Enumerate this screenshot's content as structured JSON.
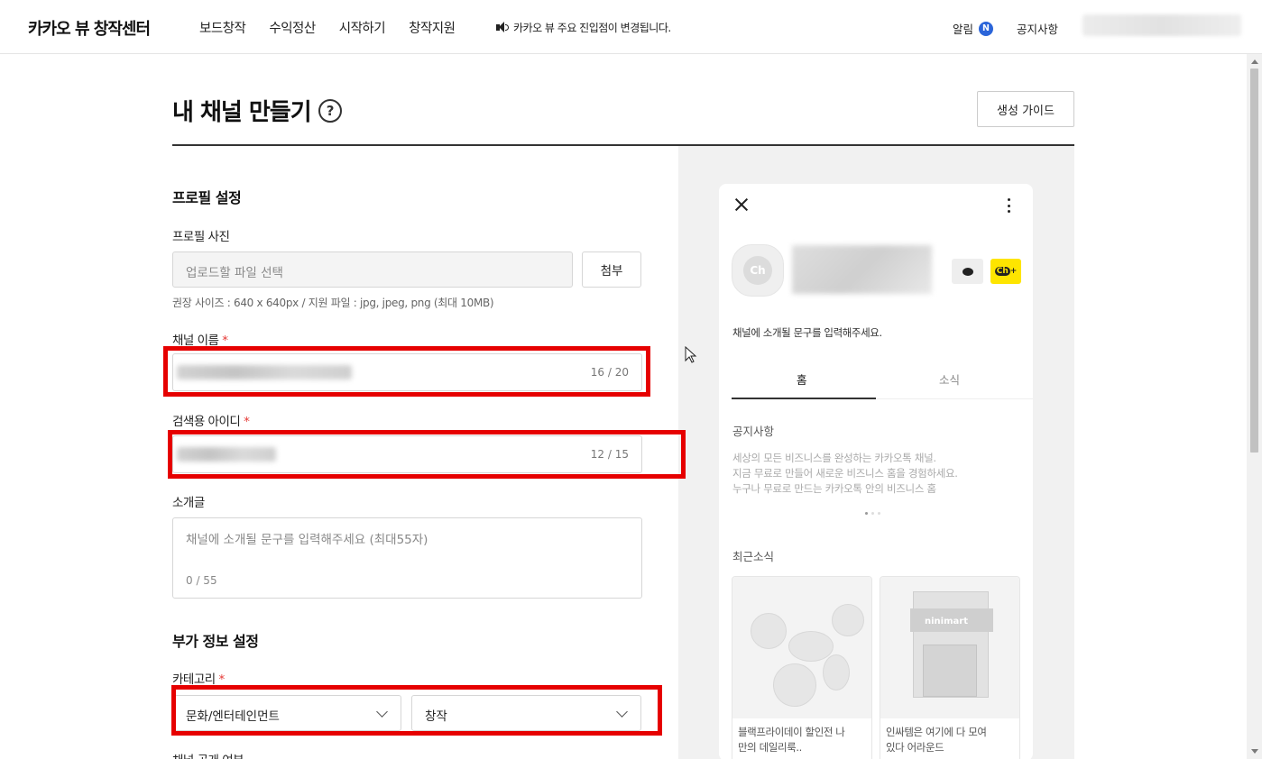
{
  "header": {
    "logo": "카카오 뷰 창작센터",
    "nav": [
      "보드창작",
      "수익정산",
      "시작하기",
      "창작지원"
    ],
    "notice": "카카오 뷰 주요 진입점이 변경됩니다.",
    "alarm_label": "알림",
    "alarm_badge": "N",
    "notice_link": "공지사항"
  },
  "page": {
    "title": "내 채널 만들기",
    "help_glyph": "?",
    "guide_button": "생성 가이드"
  },
  "profile": {
    "section_title": "프로필 설정",
    "photo_label": "프로필 사진",
    "photo_placeholder": "업로드할 파일 선택",
    "attach_button": "첨부",
    "photo_hint": "권장 사이즈 : 640 x 640px / 지원 파일 : jpg, jpeg, png (최대 10MB)",
    "name_label": "채널 이름",
    "name_counter": "16 / 20",
    "id_label": "검색용 아이디",
    "id_counter": "12 / 15",
    "intro_label": "소개글",
    "intro_placeholder": "채널에 소개될 문구를 입력해주세요 (최대55자)",
    "intro_counter": "0 / 55",
    "required_mark": "*"
  },
  "extra": {
    "section_title": "부가 정보 설정",
    "category_label": "카테고리",
    "category_main": "문화/엔터테인먼트",
    "category_sub": "창작",
    "visibility_label": "채널 공개 여부"
  },
  "preview": {
    "avatar_text": "Ch",
    "add_text": "Ch",
    "intro_placeholder": "채널에 소개될 문구를 입력해주세요.",
    "tab_home": "홈",
    "tab_news": "소식",
    "notice_title": "공지사항",
    "notice_lines": [
      "세상의 모든 비즈니스를 완성하는 카카오톡 채널.",
      "지금 무료로 만들어 새로운 비즈니스 홈을 경험하세요.",
      "누구나 무료로 만드는 카카오톡 안의 비즈니스 홈"
    ],
    "recent_title": "최근소식",
    "cards": [
      {
        "caption_1": "블랙프라이데이 할인전 나",
        "caption_2": "만의 데일리룩.."
      },
      {
        "caption_1": "인싸템은 여기에 다 모여",
        "caption_2": "있다 어라운드",
        "sign": "ninimart"
      }
    ]
  },
  "colors": {
    "highlight": "#e60000",
    "badge": "#2b65d9",
    "kakao_yellow": "#fee500",
    "required": "#e53935"
  }
}
